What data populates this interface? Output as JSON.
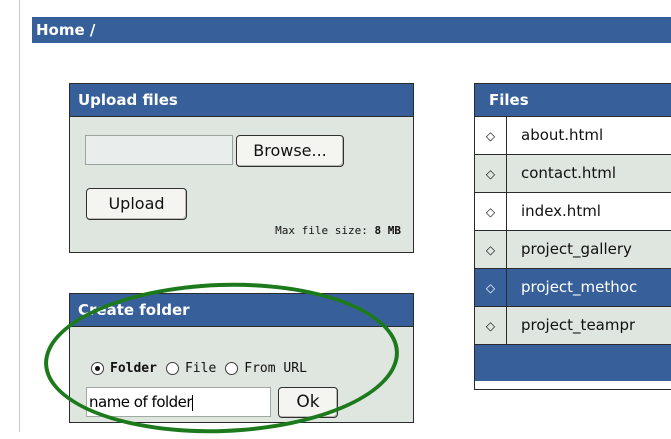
{
  "breadcrumb": {
    "text": "Home /"
  },
  "upload": {
    "title": "Upload files",
    "browse_label": "Browse...",
    "upload_label": "Upload",
    "max_size_label": "Max file size:",
    "max_size_value": "8 MB"
  },
  "create_folder": {
    "title": "Create folder",
    "options": [
      {
        "label": "Folder",
        "checked": true
      },
      {
        "label": "File",
        "checked": false
      },
      {
        "label": "From URL",
        "checked": false
      }
    ],
    "input_value": "name of folder",
    "ok_label": "Ok"
  },
  "files": {
    "title": "Files",
    "items": [
      {
        "name": "about.html",
        "selected": false
      },
      {
        "name": "contact.html",
        "selected": false
      },
      {
        "name": "index.html",
        "selected": false
      },
      {
        "name": "project_gallery",
        "selected": false
      },
      {
        "name": "project_methoc",
        "selected": true
      },
      {
        "name": "project_teampr",
        "selected": false
      }
    ]
  },
  "colors": {
    "header_blue": "#37609a",
    "panel_bg": "#dfe6df",
    "annotation_green": "#1c7a1c"
  },
  "icons": {
    "file_bullet": "diamond-outline-icon"
  }
}
